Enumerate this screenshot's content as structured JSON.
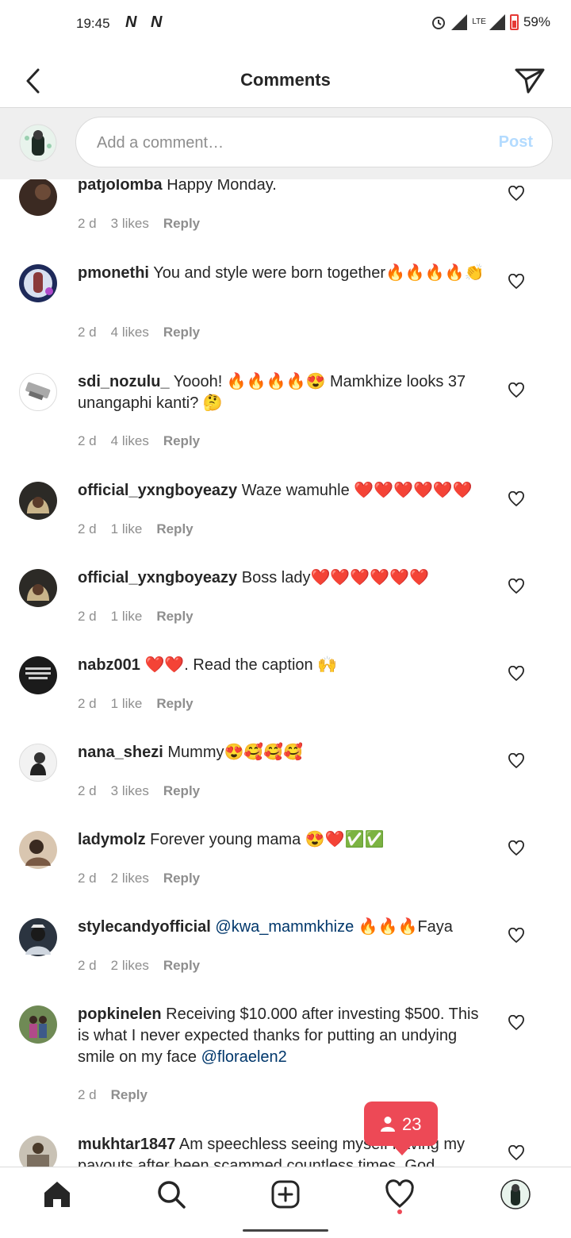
{
  "status_bar": {
    "time": "19:45",
    "network_badges": "N N",
    "lte": "LTE",
    "battery": "59%"
  },
  "header": {
    "title": "Comments",
    "back_icon": "chevron-left-icon",
    "send_icon": "paper-plane-icon"
  },
  "composer": {
    "placeholder": "Add a comment…",
    "post_label": "Post",
    "post_color": "#b3dbff"
  },
  "comments": [
    {
      "username": "patjolomba",
      "text": "Happy Monday.",
      "time": "2 d",
      "likes": "3 likes",
      "reply": "Reply"
    },
    {
      "username": "pmonethi",
      "text": "You and style were born together🔥🔥🔥🔥👏",
      "time": "2 d",
      "likes": "4 likes",
      "reply": "Reply"
    },
    {
      "username": "sdi_nozulu_",
      "text": "Yoooh! 🔥🔥🔥🔥😍 Mamkhize looks 37 unangaphi kanti? 🤔",
      "time": "2 d",
      "likes": "4 likes",
      "reply": "Reply"
    },
    {
      "username": "official_yxngboyeazy",
      "text": "Waze wamuhle ❤️❤️❤️❤️❤️❤️",
      "time": "2 d",
      "likes": "1 like",
      "reply": "Reply"
    },
    {
      "username": "official_yxngboyeazy",
      "text": "Boss lady❤️❤️❤️❤️❤️❤️",
      "time": "2 d",
      "likes": "1 like",
      "reply": "Reply"
    },
    {
      "username": "nabz001",
      "text": "❤️❤️. Read the caption 🙌",
      "time": "2 d",
      "likes": "1 like",
      "reply": "Reply"
    },
    {
      "username": "nana_shezi",
      "text": "Mummy😍🥰🥰🥰",
      "time": "2 d",
      "likes": "3 likes",
      "reply": "Reply"
    },
    {
      "username": "ladymolz",
      "text": "Forever young mama 😍❤️✅✅",
      "time": "2 d",
      "likes": "2 likes",
      "reply": "Reply"
    },
    {
      "username": "stylecandyofficial",
      "mention": "@kwa_mammkhize",
      "text": " 🔥🔥🔥Faya",
      "time": "2 d",
      "likes": "2 likes",
      "reply": "Reply"
    },
    {
      "username": "popkinelen",
      "text": "Receiving $10.000 after investing $500. This is what I never expected thanks for putting an undying smile on my face ",
      "mention_after": "@floraelen2",
      "time": "2 d",
      "reply": "Reply"
    },
    {
      "username": "mukhtar1847",
      "text": "Am speechless seeing myself having my payouts after been scammed countless times. God"
    }
  ],
  "activity_badge": {
    "count": "23",
    "icon": "person-icon",
    "color": "#ed4956"
  },
  "tab_bar": {
    "home": "home-icon",
    "search": "search-icon",
    "new_post": "plus-square-icon",
    "activity": "heart-icon",
    "profile": "profile-avatar"
  }
}
